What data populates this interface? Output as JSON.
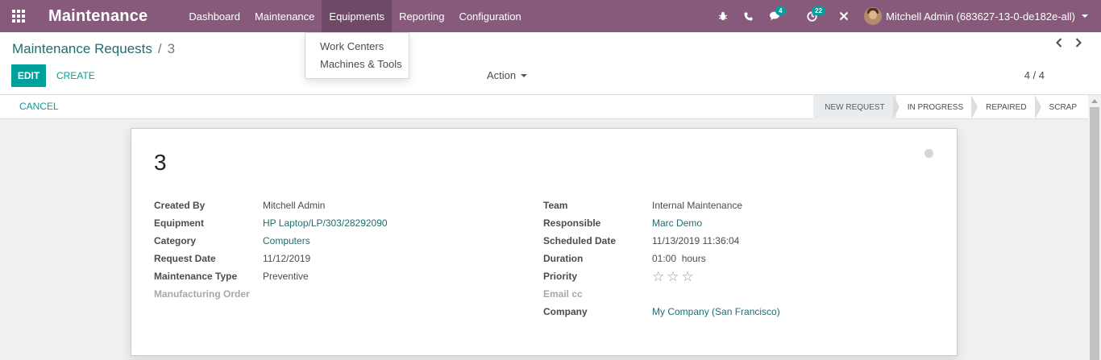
{
  "navbar": {
    "brand": "Maintenance",
    "menu": [
      "Dashboard",
      "Maintenance",
      "Equipments",
      "Reporting",
      "Configuration"
    ],
    "active_menu": "Equipments",
    "messages_count": "4",
    "activities_count": "22",
    "user_name": "Mitchell Admin (683627-13-0-de182e-all)"
  },
  "dropdown": {
    "items": [
      "Work Centers",
      "Machines & Tools"
    ]
  },
  "control_panel": {
    "breadcrumb_parent": "Maintenance Requests",
    "breadcrumb_separator": "/",
    "breadcrumb_current": "3",
    "edit_label": "EDIT",
    "create_label": "CREATE",
    "action_label": "Action",
    "pager": "4 / 4"
  },
  "statusbar": {
    "cancel_label": "CANCEL",
    "stages": [
      "NEW REQUEST",
      "IN PROGRESS",
      "REPAIRED",
      "SCRAP"
    ],
    "current_stage": "NEW REQUEST"
  },
  "form": {
    "title": "3",
    "left": [
      {
        "label": "Created By",
        "value": "Mitchell Admin",
        "link": false
      },
      {
        "label": "Equipment",
        "value": "HP Laptop/LP/303/28292090",
        "link": true
      },
      {
        "label": "Category",
        "value": "Computers",
        "link": true
      },
      {
        "label": "Request Date",
        "value": "11/12/2019",
        "link": false
      },
      {
        "label": "Maintenance Type",
        "value": "Preventive",
        "link": false
      },
      {
        "label": "Manufacturing Order",
        "value": "",
        "link": false
      }
    ],
    "right": [
      {
        "label": "Team",
        "value": "Internal Maintenance",
        "link": false
      },
      {
        "label": "Responsible",
        "value": "Marc Demo",
        "link": true
      },
      {
        "label": "Scheduled Date",
        "value": "11/13/2019 11:36:04",
        "link": false
      },
      {
        "label": "Duration",
        "value": "01:00  hours",
        "link": false
      },
      {
        "label": "Priority",
        "value": "",
        "link": false
      },
      {
        "label": "Email cc",
        "value": "",
        "link": false
      },
      {
        "label": "Company",
        "value": "My Company (San Francisco)",
        "link": true
      }
    ],
    "priority_stars": 0,
    "priority_max": 3
  },
  "colors": {
    "navbar": "#875a7b",
    "accent": "#00a09d",
    "link": "#1f6e70"
  }
}
